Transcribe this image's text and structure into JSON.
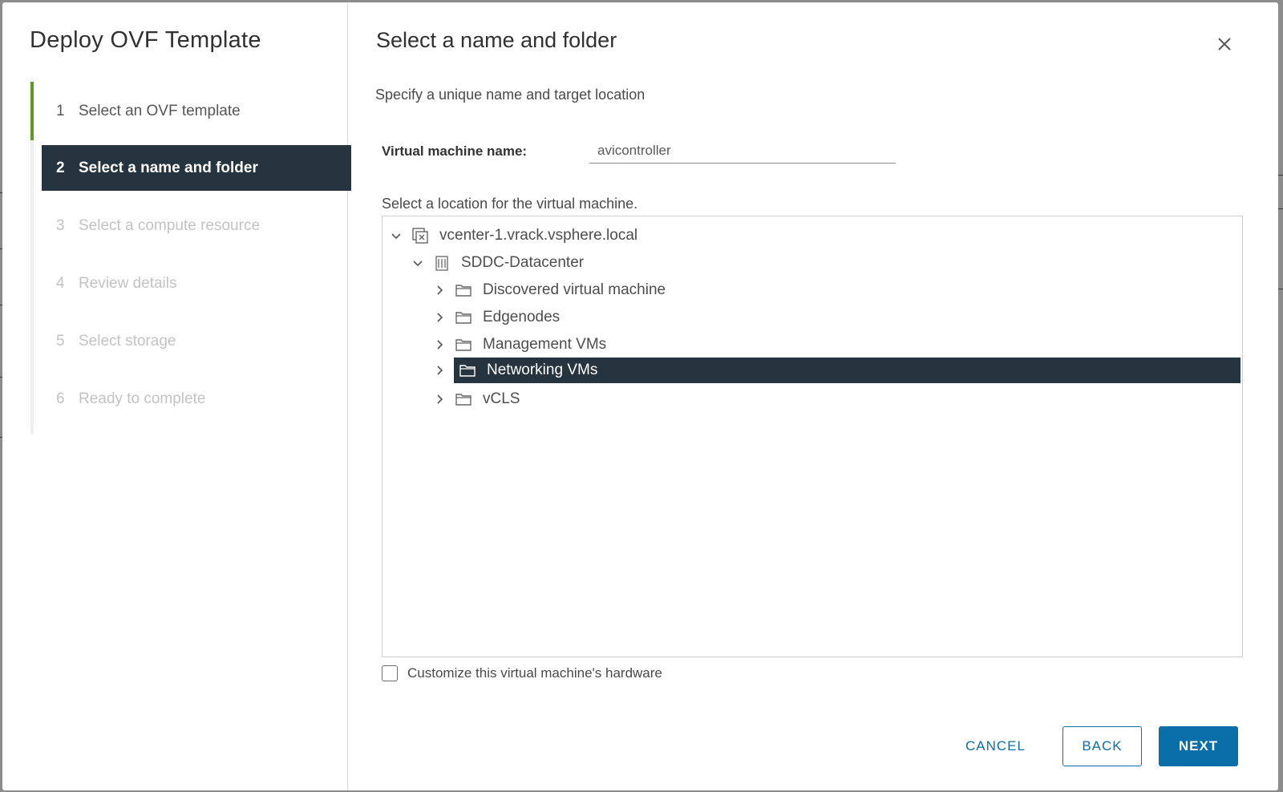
{
  "dialog": {
    "title": "Deploy OVF Template",
    "steps": [
      {
        "num": "1",
        "label": "Select an OVF template",
        "state": "completed"
      },
      {
        "num": "2",
        "label": "Select a name and folder",
        "state": "active"
      },
      {
        "num": "3",
        "label": "Select a compute resource",
        "state": "disabled"
      },
      {
        "num": "4",
        "label": "Review details",
        "state": "disabled"
      },
      {
        "num": "5",
        "label": "Select storage",
        "state": "disabled"
      },
      {
        "num": "6",
        "label": "Ready to complete",
        "state": "disabled"
      }
    ]
  },
  "main": {
    "title": "Select a name and folder",
    "subtitle": "Specify a unique name and target location",
    "vm_name_label": "Virtual machine name:",
    "vm_name_value": "avicontroller",
    "location_label": "Select a location for the virtual machine.",
    "tree": [
      {
        "label": "vcenter-1.vrack.vsphere.local",
        "icon": "vcenter-icon",
        "expanded": true,
        "level": 0
      },
      {
        "label": "SDDC-Datacenter",
        "icon": "datacenter-icon",
        "expanded": true,
        "level": 1
      },
      {
        "label": "Discovered virtual machine",
        "icon": "folder-icon",
        "expanded": false,
        "level": 2
      },
      {
        "label": "Edgenodes",
        "icon": "folder-icon",
        "expanded": false,
        "level": 2
      },
      {
        "label": "Management VMs",
        "icon": "folder-icon",
        "expanded": false,
        "level": 2
      },
      {
        "label": "Networking VMs",
        "icon": "folder-icon",
        "expanded": false,
        "level": 2,
        "selected": true
      },
      {
        "label": "vCLS",
        "icon": "folder-icon",
        "expanded": false,
        "level": 2
      }
    ],
    "customize_label": "Customize this virtual machine's hardware",
    "customize_checked": false
  },
  "footer": {
    "cancel_label": "CANCEL",
    "back_label": "BACK",
    "next_label": "NEXT"
  },
  "colors": {
    "active_bg": "#25343f",
    "accent_blue": "#0a6fa8",
    "progress_green": "#5a9a22"
  }
}
